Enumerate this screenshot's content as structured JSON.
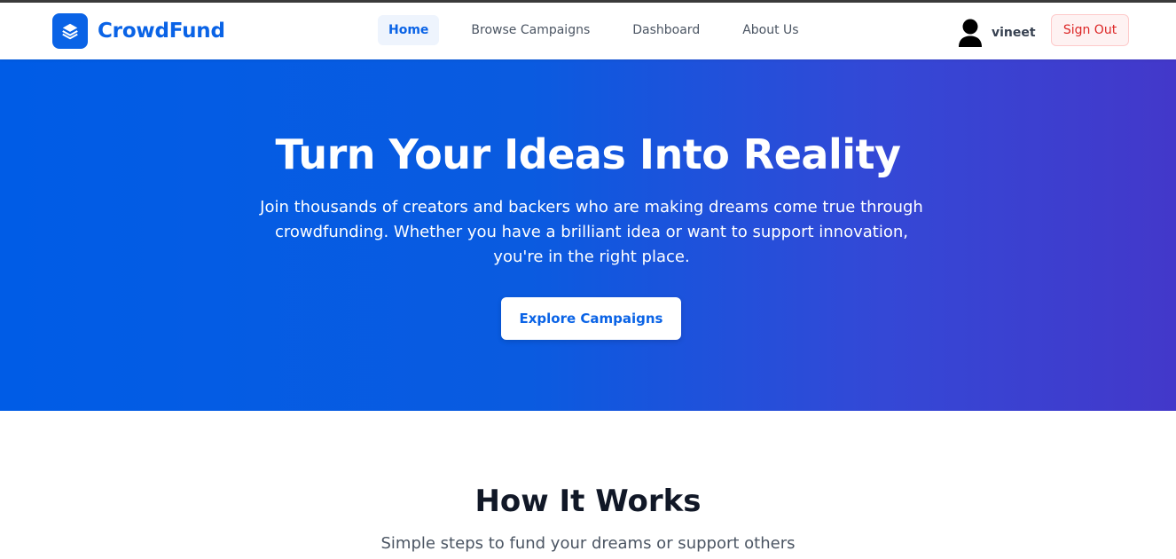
{
  "brand": {
    "name": "CrowdFund",
    "logo_icon": "layers-icon"
  },
  "nav": {
    "items": [
      {
        "label": "Home",
        "active": true
      },
      {
        "label": "Browse Campaigns",
        "active": false
      },
      {
        "label": "Dashboard",
        "active": false
      },
      {
        "label": "About Us",
        "active": false
      }
    ]
  },
  "user": {
    "avatar_icon": "user-avatar-icon",
    "name": "vineet",
    "signout_label": "Sign Out"
  },
  "hero": {
    "title": "Turn Your Ideas Into Reality",
    "text": "Join thousands of creators and backers who are making dreams come true through crowdfunding. Whether you have a brilliant idea or want to support innovation, you're in the right place.",
    "cta_label": "Explore Campaigns"
  },
  "how_it_works": {
    "title": "How It Works",
    "subtitle": "Simple steps to fund your dreams or support others"
  },
  "colors": {
    "primary": "#0a63e6",
    "gradient_start": "#005ce6",
    "gradient_end": "#4338ca",
    "danger": "#dc2626",
    "danger_bg": "#fef2f2"
  }
}
